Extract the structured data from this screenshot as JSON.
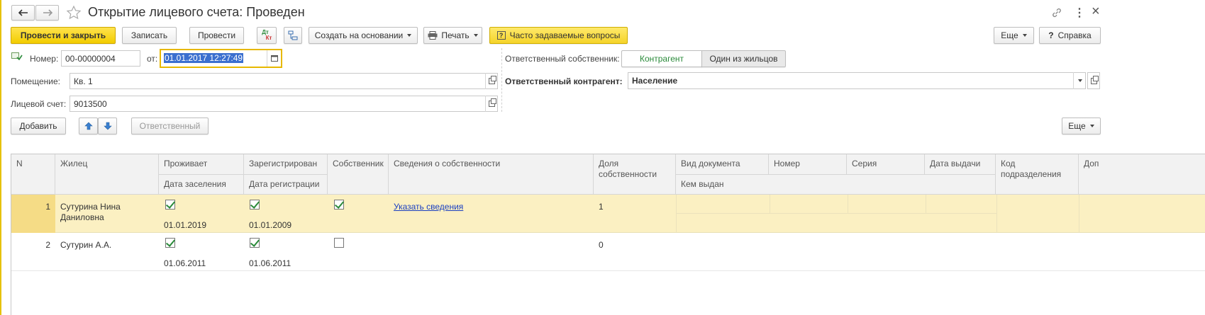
{
  "window": {
    "title": "Открытие лицевого счета: Проведен",
    "more_icon": "⋮",
    "close_icon": "×"
  },
  "toolbar": {
    "post_close": "Провести и закрыть",
    "save": "Записать",
    "post": "Провести",
    "dt_kt_top": "Дт",
    "dt_kt_bottom": "Кт",
    "create_based": "Создать на основании",
    "print": "Печать",
    "faq": "Часто задаваемые вопросы",
    "more": "Еще",
    "help": "Справка"
  },
  "header": {
    "number_label": "Номер:",
    "number_value": "00-00000004",
    "date_label": "от:",
    "date_value": "01.01.2017 12:27:49",
    "premises_label": "Помещение:",
    "premises_value": "Кв. 1",
    "account_label": "Лицевой счет:",
    "account_value": "9013500",
    "resp_owner_label": "Ответственный собственник:",
    "resp_owner_opt1": "Контрагент",
    "resp_owner_opt2": "Один из жильцов",
    "resp_contractor_label": "Ответственный контрагент:",
    "resp_contractor_value": "Население"
  },
  "table_toolbar": {
    "add": "Добавить",
    "responsible": "Ответственный",
    "more": "Еще"
  },
  "columns": {
    "n": "N",
    "resident": "Жилец",
    "lives": "Проживает",
    "settle_date": "Дата заселения",
    "registered": "Зарегистрирован",
    "reg_date": "Дата регистрации",
    "owner": "Собственник",
    "owner_info": "Сведения о собственности",
    "share": "Доля собственности",
    "doc_type": "Вид документа",
    "issued_by": "Кем выдан",
    "number": "Номер",
    "series": "Серия",
    "issue_date": "Дата выдачи",
    "dept_code": "Код подразделения",
    "extra": "Доп"
  },
  "rows": [
    {
      "n": "1",
      "resident": "Сутурина Нина Даниловна",
      "lives": true,
      "settle_date": "01.01.2019",
      "registered": true,
      "reg_date": "01.01.2009",
      "owner": true,
      "owner_info": "Указать сведения",
      "share": "1"
    },
    {
      "n": "2",
      "resident": "Сутурин А.А.",
      "lives": true,
      "settle_date": "01.06.2011",
      "registered": true,
      "reg_date": "01.06.2011",
      "owner": false,
      "owner_info": "",
      "share": "0"
    }
  ],
  "colors": {
    "accent_yellow": "#f5d000",
    "selected_row": "#fbf0c2",
    "link": "#1a3fc1",
    "check_green": "#2a8a3a"
  }
}
